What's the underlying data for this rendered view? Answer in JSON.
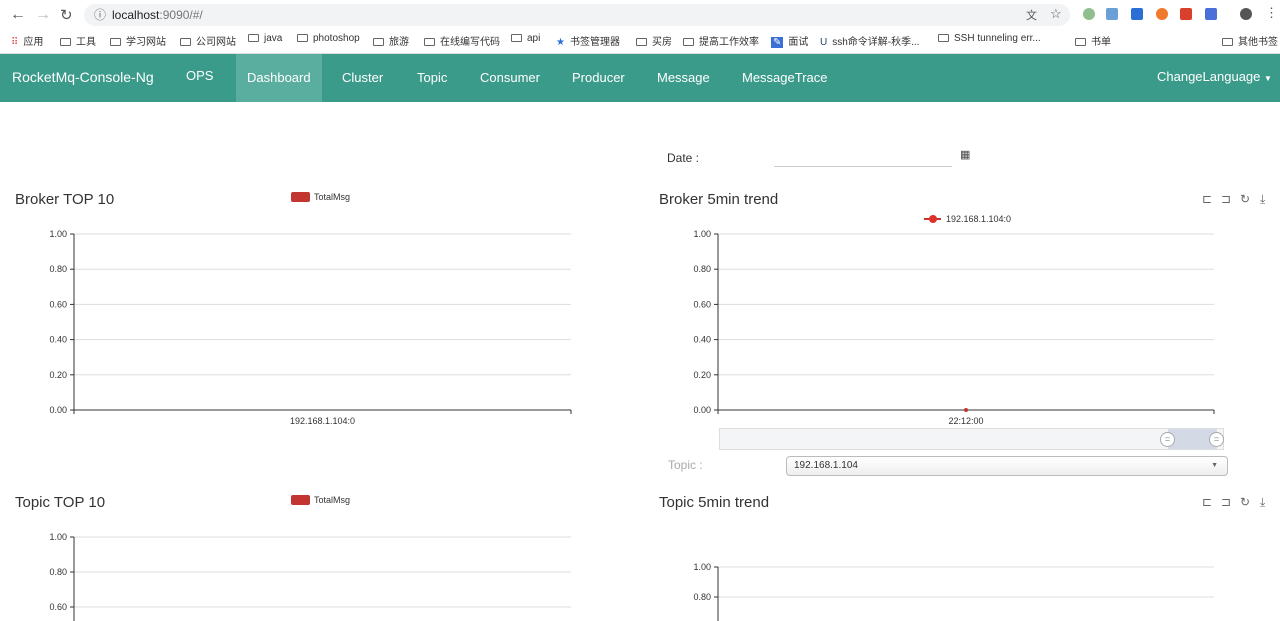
{
  "browser": {
    "url_host": "localhost",
    "url_rest": ":9090/#/",
    "bookmarks": [
      "应用",
      "工具",
      "学习网站",
      "公司网站",
      "java",
      "photoshop",
      "旅游",
      "在线编写代码",
      "api",
      "书签管理器",
      "买房",
      "提高工作效率",
      "面试",
      "ssh命令详解-秋季...",
      "SSH tunneling err...",
      "书单"
    ],
    "other_bookmarks": "其他书签"
  },
  "nav": {
    "brand": "RocketMq-Console-Ng",
    "items": [
      "OPS",
      "Dashboard",
      "Cluster",
      "Topic",
      "Consumer",
      "Producer",
      "Message",
      "MessageTrace"
    ],
    "active": "Dashboard",
    "language": "ChangeLanguage"
  },
  "filters": {
    "date_label": "Date :",
    "date_value": "",
    "topic_label": "Topic :",
    "topic_value": "192.168.1.104"
  },
  "colors": {
    "nav": "#3b9b8b",
    "bar": "#c23531"
  },
  "chart_data": [
    {
      "type": "bar",
      "title": "Broker TOP 10",
      "legend": [
        "TotalMsg"
      ],
      "categories": [
        "192.168.1.104:0"
      ],
      "values": [
        0
      ],
      "ylim": [
        0,
        1
      ],
      "yticks": [
        "0.00",
        "0.20",
        "0.40",
        "0.60",
        "0.80",
        "1.00"
      ],
      "grid": true,
      "legend_position": "top-center"
    },
    {
      "type": "line",
      "title": "Broker 5min trend",
      "legend": [
        "192.168.1.104:0"
      ],
      "x": [
        "22:12:00"
      ],
      "values": [
        0
      ],
      "ylim": [
        0,
        1
      ],
      "yticks": [
        "0.00",
        "0.20",
        "0.40",
        "0.60",
        "0.80",
        "1.00"
      ],
      "grid": true,
      "legend_position": "top-center",
      "toolbox": [
        "zoom",
        "zoom-reset",
        "restore",
        "save"
      ]
    },
    {
      "type": "bar",
      "title": "Topic TOP 10",
      "legend": [
        "TotalMsg"
      ],
      "yticks": [
        "0.60",
        "0.80",
        "1.00"
      ],
      "grid": true,
      "legend_position": "top-center"
    },
    {
      "type": "line",
      "title": "Topic 5min trend",
      "yticks": [
        "0.80",
        "1.00"
      ],
      "grid": true,
      "toolbox": [
        "zoom",
        "zoom-reset",
        "restore",
        "save"
      ]
    }
  ]
}
